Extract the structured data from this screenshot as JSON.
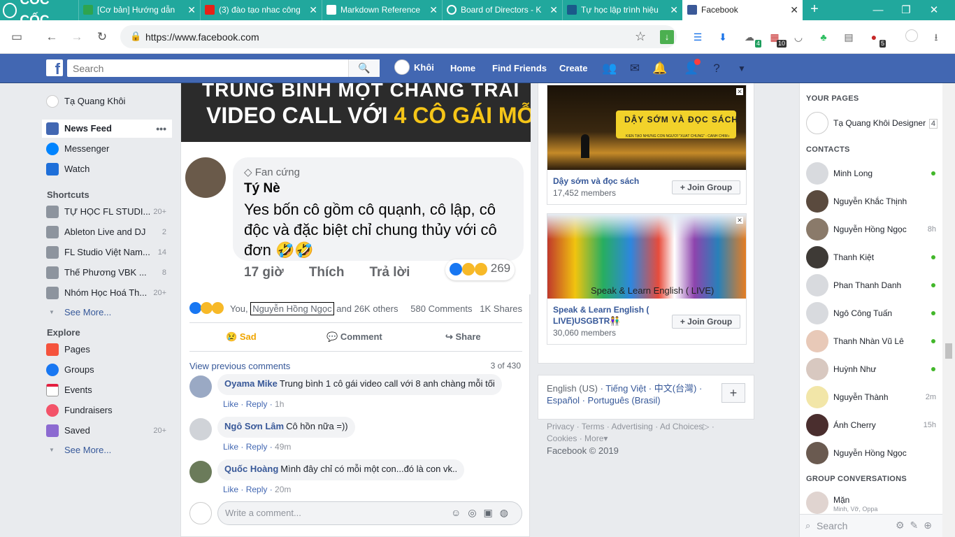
{
  "browser": {
    "brand": "CỐC CỐC",
    "tabs": [
      {
        "title": "[Cơ bản] Hướng dẫn",
        "color": "#2ea44f"
      },
      {
        "title": "(3) đào tạo nhac công",
        "color": "#e62117"
      },
      {
        "title": "Markdown Reference",
        "color": "#ffffff"
      },
      {
        "title": "Board of Directors - K",
        "color": "#ffffff"
      },
      {
        "title": "Tự học lập trình hiệu",
        "color": "#1a5a8a"
      },
      {
        "title": "Facebook",
        "color": "#3b5998"
      }
    ],
    "url": "https://www.facebook.com",
    "ext_badges": {
      "cloud": "4",
      "calendar": "10",
      "adblock": "5"
    }
  },
  "fbnav": {
    "search_placeholder": "Search",
    "user": "Khôi",
    "links": [
      "Home",
      "Find Friends",
      "Create"
    ],
    "brand_color": "#4267b2"
  },
  "leftnav": {
    "profile": "Tạ Quang Khôi",
    "main": [
      {
        "label": "News Feed"
      },
      {
        "label": "Messenger"
      },
      {
        "label": "Watch"
      }
    ],
    "shortcuts_title": "Shortcuts",
    "shortcuts": [
      {
        "label": "TỰ HỌC FL STUDI...",
        "count": "20+"
      },
      {
        "label": "Ableton Live and DJ",
        "count": "2"
      },
      {
        "label": "FL Studio Việt Nam...",
        "count": "14"
      },
      {
        "label": "Thế Phương VBK ...",
        "count": "8"
      },
      {
        "label": "Nhóm Học Hoá Th...",
        "count": "20+"
      }
    ],
    "see_more": "See More...",
    "explore_title": "Explore",
    "explore": [
      {
        "label": "Pages",
        "count": ""
      },
      {
        "label": "Groups",
        "count": ""
      },
      {
        "label": "Events",
        "count": ""
      },
      {
        "label": "Fundraisers",
        "count": ""
      },
      {
        "label": "Saved",
        "count": "20+"
      }
    ]
  },
  "post": {
    "video_line1": "TRUNG BÌNH MỘT CHÀNG TRAI",
    "video_line2_a": "VIDEO CALL VỚI ",
    "video_line2_b": "4 CÔ GÁI MỖI TỐI",
    "shot_comment": {
      "badge": "Fan cứng",
      "name": "Tý Nè",
      "text": "Yes bốn cô gồm cô quạnh, cô lập, cô độc và đặc biệt chỉ chung thủy với cô đơn 🤣🤣",
      "time": "17 giờ",
      "like": "Thích",
      "reply": "Trả lời",
      "reactions": "269"
    },
    "reactions_prefix": "You,",
    "reactions_name": "Nguyễn Hồng Ngọc",
    "reactions_suffix": "and 26K others",
    "comments_count": "580 Comments",
    "shares_count": "1K Shares",
    "actions": {
      "react": "Sad",
      "comment": "Comment",
      "share": "Share"
    },
    "view_previous": "View previous comments",
    "pager": "3 of 430",
    "comments": [
      {
        "name": "Oyama Mike",
        "text": "Trung bình 1 cô gái video call với 8 anh chàng mỗi tối",
        "like": "Like",
        "reply": "Reply",
        "time": "1h"
      },
      {
        "name": "Ngô Sơn Lâm",
        "text": "Cô hồn nữa =))",
        "like": "Like",
        "reply": "Reply",
        "time": "49m"
      },
      {
        "name": "Quốc Hoàng",
        "text": "Mình đây chỉ có mỗi một con...đó là con vk..",
        "like": "Like",
        "reply": "Reply",
        "time": "20m"
      }
    ],
    "write_placeholder": "Write a comment..."
  },
  "groups": [
    {
      "img_text": "DẬY SỚM VÀ ĐỌC SÁCH",
      "img_sub": "KIẾN TẠO NHỮNG CON NGƯỜI \"XUẤT CHÚNG\" - CÁNH CHIM AS",
      "name": "Dậy sớm và đọc sách",
      "members": "17,452 members",
      "join": "Join Group"
    },
    {
      "img_text": "Speak & Learn English ( LIVE)",
      "img_sub": "",
      "name": "Speak & Learn English ( LIVE)USGBTR👫",
      "members": "30,060 members",
      "join": "Join Group"
    }
  ],
  "languages": {
    "current": "English (US)",
    "others": [
      "Tiếng Việt",
      "中文(台灣)",
      "Español",
      "Português (Brasil)"
    ]
  },
  "footer": {
    "links": [
      "Privacy",
      "Terms",
      "Advertising",
      "Ad Choices",
      "Cookies",
      "More"
    ],
    "copyright": "Facebook © 2019"
  },
  "chat": {
    "your_pages_title": "YOUR PAGES",
    "page": {
      "name": "Tạ Quang Khôi Designer",
      "count": "4"
    },
    "contacts_title": "CONTACTS",
    "contacts": [
      {
        "name": "Minh Long",
        "status": "online"
      },
      {
        "name": "Nguyễn Khắc Thịnh",
        "status": ""
      },
      {
        "name": "Nguyễn Hồng Ngọc",
        "status": "8h"
      },
      {
        "name": "Thanh Kiệt",
        "status": "online"
      },
      {
        "name": "Phan Thanh Danh",
        "status": "online"
      },
      {
        "name": "Ngô Công Tuấn",
        "status": "online"
      },
      {
        "name": "Thanh Nhàn Vũ Lê",
        "status": "online"
      },
      {
        "name": "Huỳnh Như",
        "status": "online"
      },
      {
        "name": "Nguyễn Thành",
        "status": "2m"
      },
      {
        "name": "Ánh Cherry",
        "status": "15h"
      },
      {
        "name": "Nguyễn Hồng Ngọc",
        "status": ""
      }
    ],
    "group_title": "GROUP CONVERSATIONS",
    "group": {
      "name": "Mặn",
      "members": "Minh, Vỡ, Oppa"
    },
    "search_placeholder": "Search"
  }
}
